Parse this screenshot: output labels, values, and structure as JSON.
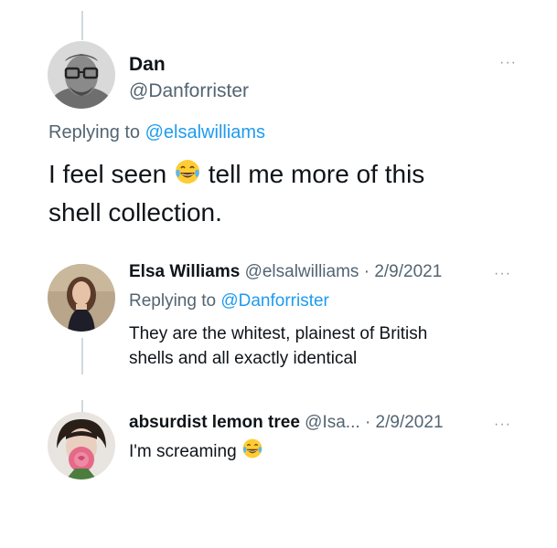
{
  "main_tweet": {
    "display_name": "Dan",
    "handle": "@Danforrister",
    "replying_prefix": "Replying to",
    "replying_to": "@elsalwilliams",
    "text_part1": "I feel seen",
    "text_part2": "tell me more of this",
    "text_line2": "shell collection.",
    "more_icon": "ellipsis-icon",
    "emoji": "face-with-tears-of-joy"
  },
  "reply_1": {
    "display_name": "Elsa Williams",
    "handle": "@elsalwilliams",
    "separator": "·",
    "date": "2/9/2021",
    "replying_prefix": "Replying to",
    "replying_to": "@Danforrister",
    "text_line1": "They are the whitest, plainest of British",
    "text_line2": "shells and all exactly identical"
  },
  "reply_2": {
    "display_name": "absurdist lemon tree",
    "handle": "@Isa...",
    "separator": "·",
    "date": "2/9/2021",
    "text": "I'm screaming",
    "emoji": "face-with-tears-of-joy"
  },
  "colors": {
    "link": "#1d9bf0",
    "muted": "#536471",
    "thread_line": "#cfd9de"
  }
}
